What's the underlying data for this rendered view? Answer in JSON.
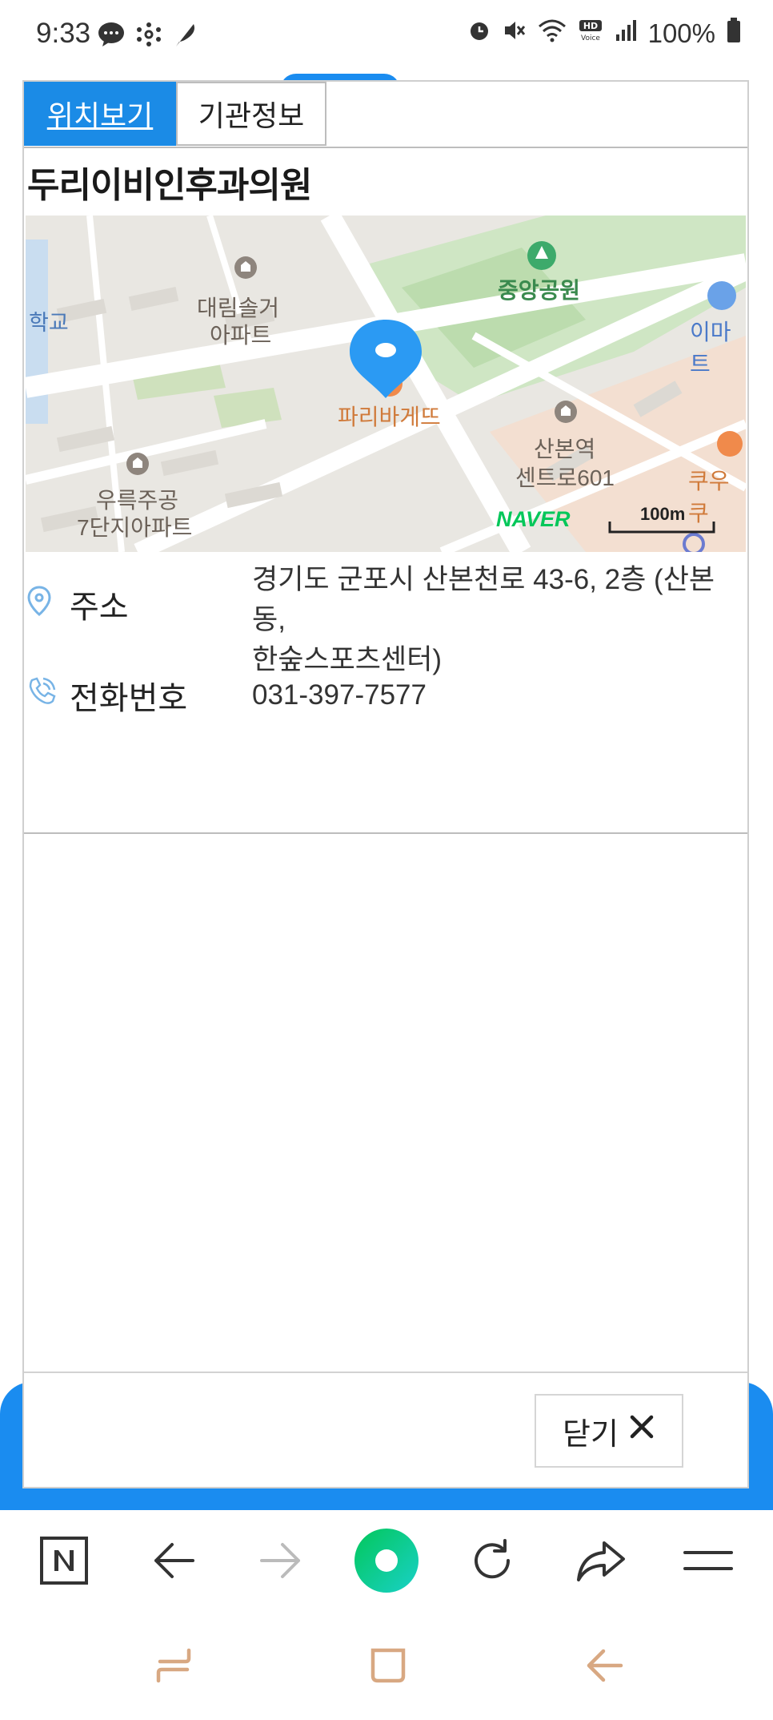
{
  "status_bar": {
    "time": "9:33",
    "battery": "100%",
    "left_icons": [
      "chat-bubble-icon",
      "network-icon",
      "feather-icon"
    ],
    "right_icons": [
      "alarm-icon",
      "mute-icon",
      "wifi-icon",
      "hd-voice-icon",
      "signal-icon",
      "battery-icon"
    ]
  },
  "tabs": [
    {
      "label": "위치보기",
      "active": true
    },
    {
      "label": "기관정보",
      "active": false
    }
  ],
  "clinic": {
    "name": "두리이비인후과의원"
  },
  "map": {
    "labels": {
      "school": "학교",
      "apt1_line1": "대림솔거",
      "apt1_line2": "아파트",
      "park": "중앙공원",
      "emart": "이마트",
      "bakery": "파리바게뜨",
      "apt2_line1": "우륵주공",
      "apt2_line2": "7단지아파트",
      "centro_line1": "산본역",
      "centro_line2": "센트로601",
      "kuu": "쿠우쿠",
      "brand": "NAVER",
      "scale": "100m"
    }
  },
  "info": {
    "address_label": "주소",
    "address_line1": "경기도 군포시 산본천로 43-6, 2층 (산본동,",
    "address_line2": "한숲스포츠센터)",
    "phone_label": "전화번호",
    "phone_value": "031-397-7577"
  },
  "footer": {
    "close_label": "닫기"
  },
  "colors": {
    "accent": "#1b8be6",
    "pin": "#2b9af3",
    "naver_green": "#03c75a"
  },
  "browser_toolbar": [
    "naver-home-icon",
    "back-arrow-icon",
    "forward-arrow-icon",
    "green-dot-icon",
    "refresh-icon",
    "share-icon",
    "menu-icon"
  ],
  "system_nav": [
    "recent-apps-icon",
    "home-icon",
    "back-icon"
  ]
}
